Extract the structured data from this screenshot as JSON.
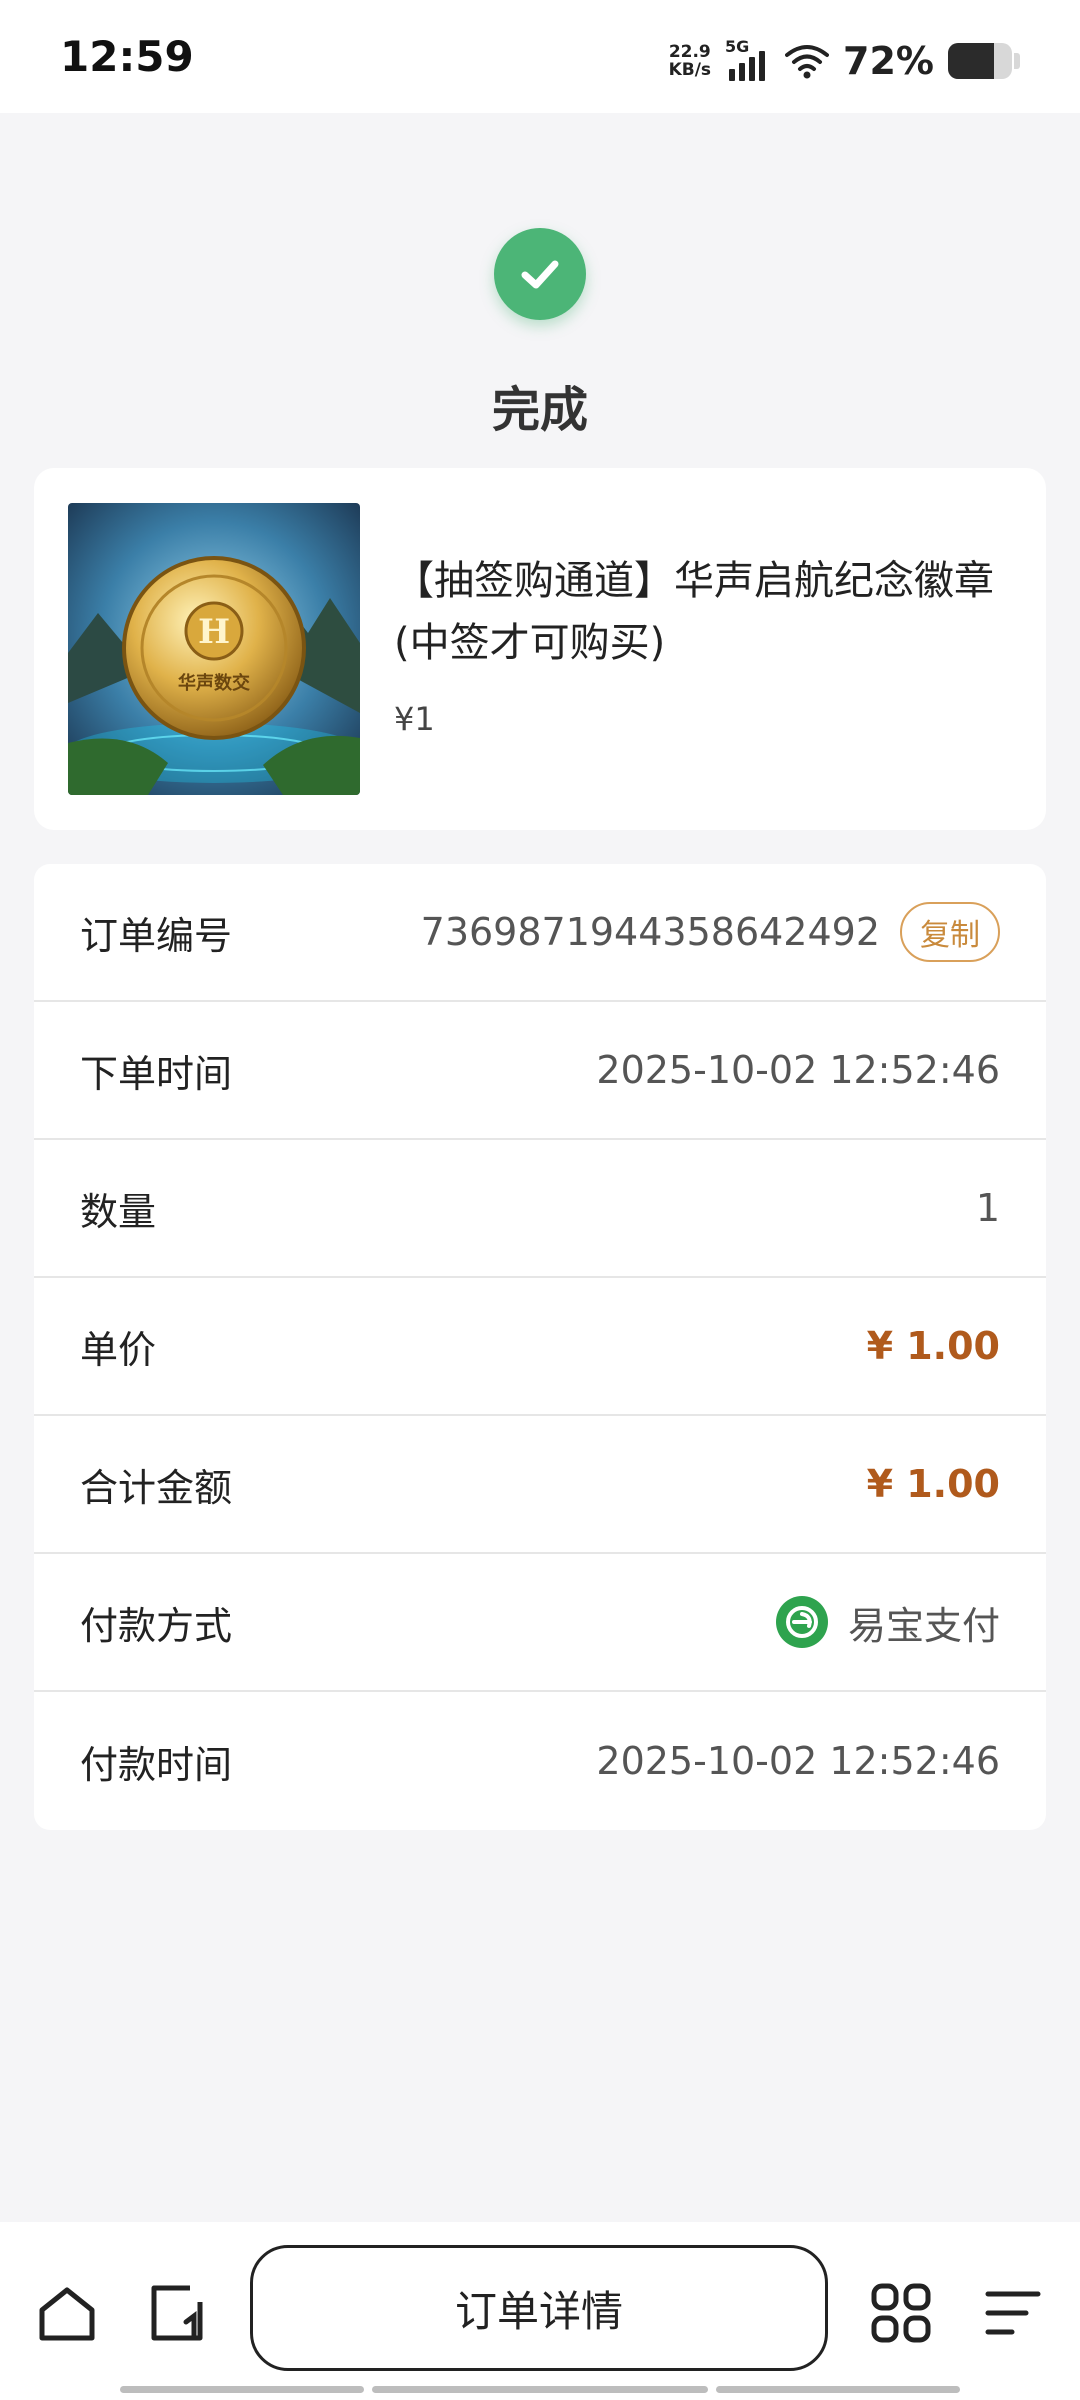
{
  "status_bar": {
    "time": "12:59",
    "net_speed_value": "22.9",
    "net_speed_unit": "KB/s",
    "network": "5G",
    "battery_percent": "72%",
    "battery_level": 0.72
  },
  "header": {
    "status_icon": "check-circle-icon",
    "title": "完成"
  },
  "product": {
    "title": "【抽签购通道】华声启航纪念徽章(中签才可购买)",
    "price": "¥1",
    "image_text": "华声数交"
  },
  "order": {
    "rows": [
      {
        "label": "订单编号",
        "value": "7369871944358642492",
        "action": "复制"
      },
      {
        "label": "下单时间",
        "value": "2025-10-02 12:52:46"
      },
      {
        "label": "数量",
        "value": "1"
      },
      {
        "label": "单价",
        "value": "¥ 1.00"
      },
      {
        "label": "合计金额",
        "value": "¥ 1.00"
      },
      {
        "label": "付款方式",
        "value": "易宝支付"
      },
      {
        "label": "付款时间",
        "value": "2025-10-02 12:52:46"
      }
    ]
  },
  "bottom_bar": {
    "main_button": "订单详情",
    "icons": [
      "home-icon",
      "tab-switch-icon",
      "apps-grid-icon",
      "menu-icon"
    ]
  },
  "colors": {
    "accent_price": "#b05a1c",
    "success": "#4cb577",
    "copy_border": "#d9a05a",
    "pay_green": "#2ea34e"
  }
}
